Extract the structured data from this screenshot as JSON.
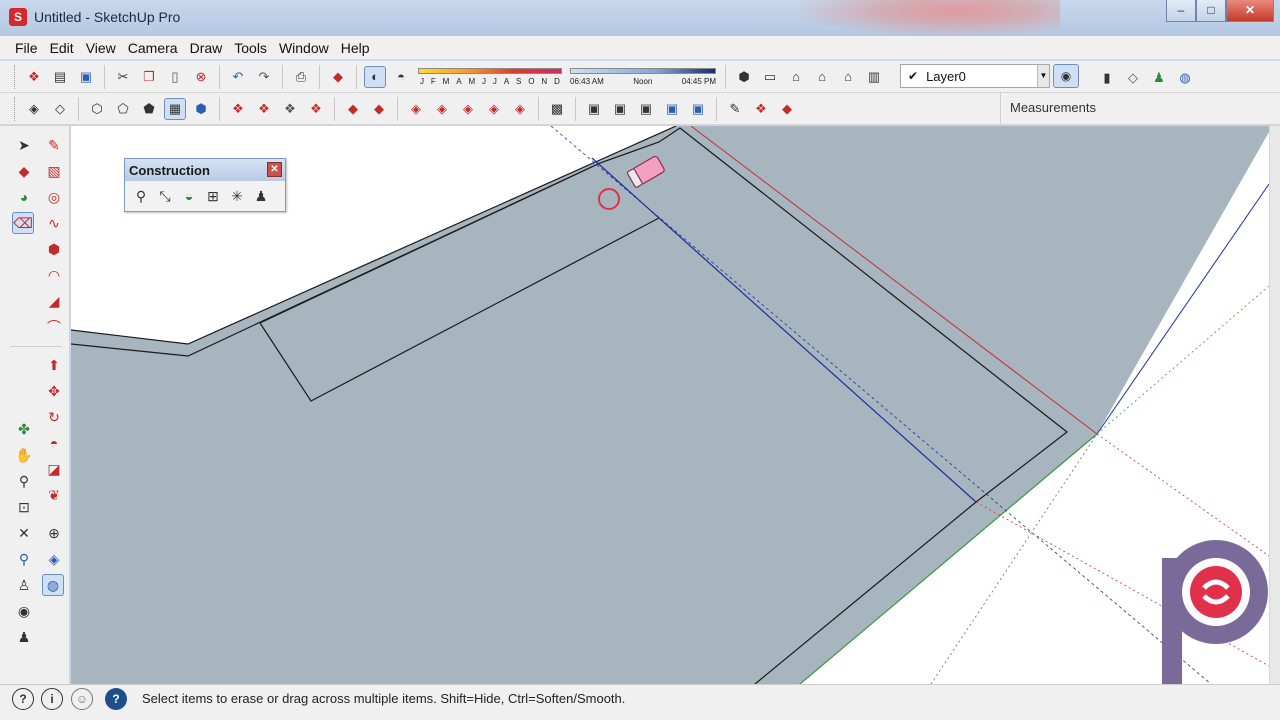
{
  "window": {
    "title": "Untitled - SketchUp Pro",
    "app_icon": "sketchup-logo-icon",
    "controls": [
      "minimize-icon",
      "maximize-icon",
      "close-icon"
    ]
  },
  "menu": [
    "File",
    "Edit",
    "View",
    "Camera",
    "Draw",
    "Tools",
    "Window",
    "Help"
  ],
  "shadows": {
    "months": [
      "J",
      "F",
      "M",
      "A",
      "M",
      "J",
      "J",
      "A",
      "S",
      "O",
      "N",
      "D"
    ],
    "time_start": "06:43 AM",
    "time_mid": "Noon",
    "time_end": "04:45 PM"
  },
  "layer": {
    "current": "Layer0"
  },
  "measurements": {
    "label": "Measurements"
  },
  "construction_toolbar": {
    "title": "Construction"
  },
  "status": {
    "hint": "Select items to erase or drag across multiple items. Shift=Hide, Ctrl=Soften/Smooth."
  },
  "colors": {
    "face": "#a7b5bf",
    "edge": "#1a1a1a",
    "blue_axis": "#1d2fa0",
    "red_axis": "#c43030",
    "green_axis": "#3b9a3b",
    "accent_logo": "#e0304a"
  }
}
